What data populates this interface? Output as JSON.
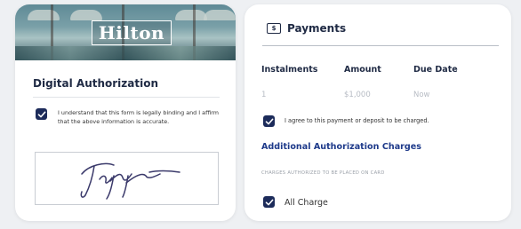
{
  "left_card": {
    "logo_text": "Hilton",
    "title": "Digital Authorization",
    "consent_text": "I understand that this form is legally binding and I affirm that the above information is accurate.",
    "consent_checked": true
  },
  "right_card": {
    "title": "Payments",
    "columns": [
      "Instalments",
      "Amount",
      "Due Date"
    ],
    "row": {
      "instalments": "1",
      "amount": "$1,000",
      "due": "Now"
    },
    "agree_text": "I agree to this payment or deposit to be charged.",
    "agree_checked": true,
    "additional_title": "Additional Authorization Charges",
    "charges_label": "CHARGES AUTHORIZED TO BE PLACED ON CARD",
    "all_charge_label": "All Charge",
    "all_charge_checked": true
  },
  "colors": {
    "accent": "#1c2b5a",
    "link_blue": "#1e3a8a",
    "background": "#eef0f3"
  }
}
